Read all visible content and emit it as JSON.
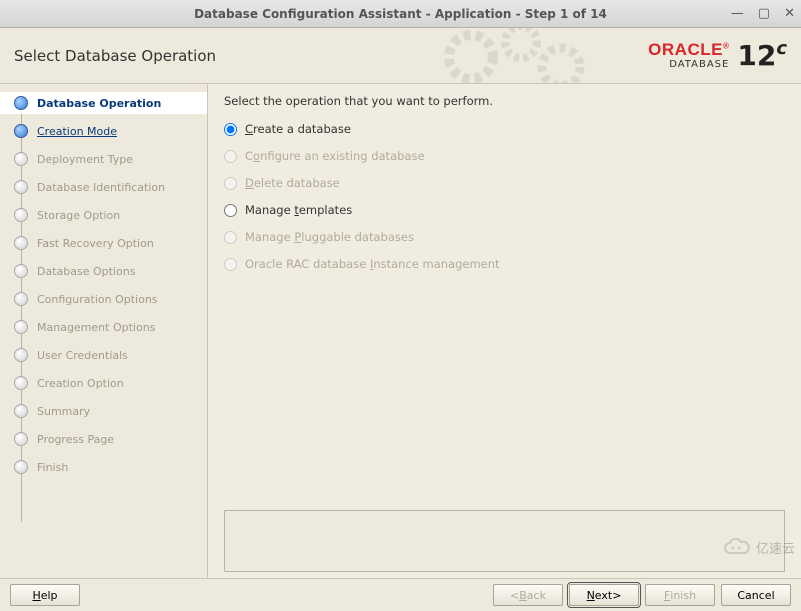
{
  "window": {
    "title": "Database Configuration Assistant - Application - Step 1 of 14"
  },
  "header": {
    "page_title": "Select Database Operation",
    "brand_word": "ORACLE",
    "brand_sub": "DATABASE",
    "brand_version": "12",
    "brand_edition": "c"
  },
  "sidebar": {
    "steps": [
      {
        "label": "Database Operation",
        "state": "current"
      },
      {
        "label": "Creation Mode",
        "state": "active-link"
      },
      {
        "label": "Deployment Type",
        "state": "disabled"
      },
      {
        "label": "Database Identification",
        "state": "disabled"
      },
      {
        "label": "Storage Option",
        "state": "disabled"
      },
      {
        "label": "Fast Recovery Option",
        "state": "disabled"
      },
      {
        "label": "Database Options",
        "state": "disabled"
      },
      {
        "label": "Configuration Options",
        "state": "disabled"
      },
      {
        "label": "Management Options",
        "state": "disabled"
      },
      {
        "label": "User Credentials",
        "state": "disabled"
      },
      {
        "label": "Creation Option",
        "state": "disabled"
      },
      {
        "label": "Summary",
        "state": "disabled"
      },
      {
        "label": "Progress Page",
        "state": "disabled"
      },
      {
        "label": "Finish",
        "state": "disabled"
      }
    ]
  },
  "main": {
    "prompt": "Select the operation that you want to perform.",
    "options": [
      {
        "pre": "",
        "mn": "C",
        "post": "reate a database",
        "enabled": true,
        "selected": true
      },
      {
        "pre": "C",
        "mn": "o",
        "post": "nfigure an existing database",
        "enabled": false,
        "selected": false
      },
      {
        "pre": "",
        "mn": "D",
        "post": "elete database",
        "enabled": false,
        "selected": false
      },
      {
        "pre": "Manage ",
        "mn": "t",
        "post": "emplates",
        "enabled": true,
        "selected": false
      },
      {
        "pre": "Manage ",
        "mn": "P",
        "post": "luggable databases",
        "enabled": false,
        "selected": false
      },
      {
        "pre": "Oracle RAC database ",
        "mn": "I",
        "post": "nstance management",
        "enabled": false,
        "selected": false
      }
    ]
  },
  "footer": {
    "help": "Help",
    "back": "Back",
    "next": "Next",
    "finish": "Finish",
    "cancel": "Cancel"
  },
  "watermark": "亿速云"
}
